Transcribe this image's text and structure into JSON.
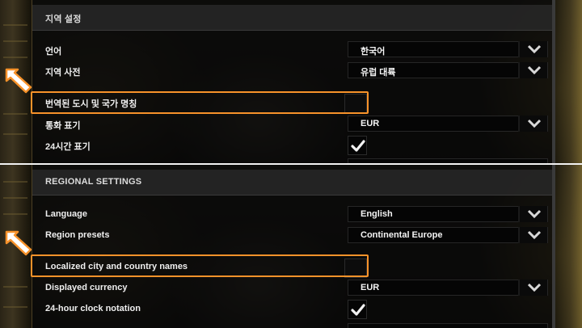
{
  "top_panel": {
    "section_title": "지역 설정",
    "rows": [
      {
        "label": "언어",
        "value": "한국어"
      },
      {
        "label": "지역 사전",
        "value": "유럽 대륙"
      },
      {
        "label": "번역된 도시 및 국가 명칭",
        "checked": false
      },
      {
        "label": "통화 표기",
        "value": "EUR"
      },
      {
        "label": "24시간 표기",
        "checked": true
      }
    ]
  },
  "bottom_panel": {
    "section_title": "REGIONAL SETTINGS",
    "rows": [
      {
        "label": "Language",
        "value": "English"
      },
      {
        "label": "Region presets",
        "value": "Continental Europe"
      },
      {
        "label": "Localized city and country names",
        "checked": false
      },
      {
        "label": "Displayed currency",
        "value": "EUR"
      },
      {
        "label": "24-hour clock notation",
        "checked": true
      }
    ]
  },
  "colors": {
    "highlight": "#f7922a",
    "arrow_fill": "#ffffff",
    "arrow_stroke": "#f7922a"
  }
}
